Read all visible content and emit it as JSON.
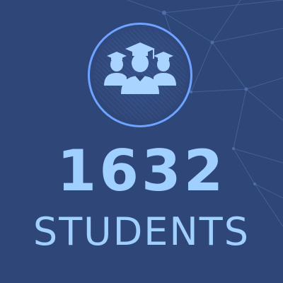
{
  "stat": {
    "count": "1632",
    "label": "STUDENTS"
  },
  "icon": "graduates-group-icon",
  "colors": {
    "background": "#2f4678",
    "accent": "#6ea3ff",
    "text": "#9fd0ff",
    "icon_fill": "#a9d4ff"
  }
}
